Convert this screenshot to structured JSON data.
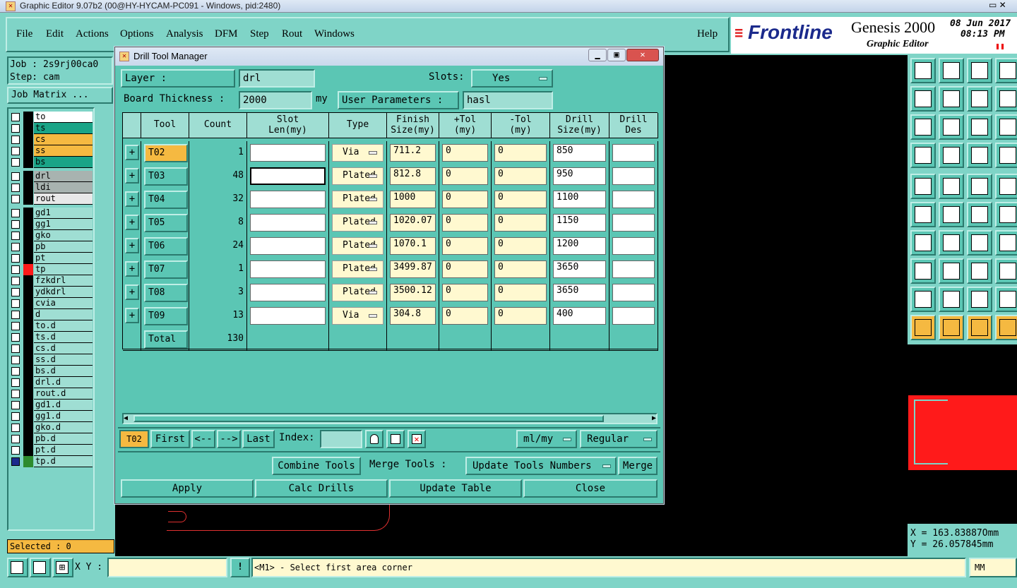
{
  "window": {
    "title": "Graphic Editor 9.07b2 (00@HY-HYCAM-PC091 - Windows, pid:2480)"
  },
  "menu": [
    "File",
    "Edit",
    "Actions",
    "Options",
    "Analysis",
    "DFM",
    "Step",
    "Rout",
    "Windows"
  ],
  "help": "Help",
  "brand": {
    "logo": "Frontline",
    "product": "Genesis 2000",
    "sub": "Graphic Editor",
    "date": "08 Jun 2017",
    "time": "08:13 PM"
  },
  "left": {
    "job": "Job : 2s9rj00ca0",
    "step": "Step: cam",
    "matrix_btn": "Job Matrix ...",
    "selected": "Selected : 0",
    "layers": [
      {
        "name": "to",
        "color": "#ffffff"
      },
      {
        "name": "ts",
        "color": "#1aa487"
      },
      {
        "name": "cs",
        "color": "#f5b941"
      },
      {
        "name": "ss",
        "color": "#f5b941"
      },
      {
        "name": "bs",
        "color": "#1aa487"
      },
      {
        "name": "drl",
        "color": "#a8b3b0"
      },
      {
        "name": "ldi",
        "color": "#a8b3b0"
      },
      {
        "name": "rout",
        "color": "#e8e8e8"
      },
      {
        "name": "gd1",
        "color": "#9fded3"
      },
      {
        "name": "gg1",
        "color": "#9fded3"
      },
      {
        "name": "gko",
        "color": "#9fded3"
      },
      {
        "name": "pb",
        "color": "#9fded3"
      },
      {
        "name": "pt",
        "color": "#9fded3"
      },
      {
        "name": "tp",
        "color": "#9fded3"
      },
      {
        "name": "fzkdrl",
        "color": "#9fded3"
      },
      {
        "name": "ydkdrl",
        "color": "#9fded3"
      },
      {
        "name": "cvia",
        "color": "#9fded3"
      },
      {
        "name": "d",
        "color": "#9fded3"
      },
      {
        "name": "to.d",
        "color": "#9fded3"
      },
      {
        "name": "ts.d",
        "color": "#9fded3"
      },
      {
        "name": "cs.d",
        "color": "#9fded3"
      },
      {
        "name": "ss.d",
        "color": "#9fded3"
      },
      {
        "name": "bs.d",
        "color": "#9fded3"
      },
      {
        "name": "drl.d",
        "color": "#9fded3"
      },
      {
        "name": "rout.d",
        "color": "#9fded3"
      },
      {
        "name": "gd1.d",
        "color": "#9fded3"
      },
      {
        "name": "gg1.d",
        "color": "#9fded3"
      },
      {
        "name": "gko.d",
        "color": "#9fded3"
      },
      {
        "name": "pb.d",
        "color": "#9fded3"
      },
      {
        "name": "pt.d",
        "color": "#9fded3"
      },
      {
        "name": "tp.d",
        "color": "#9fded3"
      }
    ]
  },
  "dialog": {
    "title": "Drill Tool Manager",
    "layer_label": "Layer         :",
    "layer": "drl",
    "slots_label": "Slots:",
    "slots": "Yes",
    "thick_label": "Board Thickness :",
    "thick": "2000",
    "thick_unit": "my",
    "user_params_label": "User Parameters :",
    "user_params": "hasl",
    "headers": [
      [
        "Tool",
        ""
      ],
      [
        "Count",
        ""
      ],
      [
        "Slot",
        "Len(my)"
      ],
      [
        "Type",
        ""
      ],
      [
        "Finish",
        "Size(my)"
      ],
      [
        "+Tol",
        "(my)"
      ],
      [
        "-Tol",
        "(my)"
      ],
      [
        "Drill",
        "Size(my)"
      ],
      [
        "Drill",
        "Des"
      ]
    ],
    "rows": [
      {
        "tool": "T02",
        "count": "1",
        "type": "Via",
        "finish": "711.2",
        "ptol": "0",
        "ntol": "0",
        "drill": "850"
      },
      {
        "tool": "T03",
        "count": "48",
        "type": "Plated",
        "finish": "812.8",
        "ptol": "0",
        "ntol": "0",
        "drill": "950"
      },
      {
        "tool": "T04",
        "count": "32",
        "type": "Plated",
        "finish": "1000",
        "ptol": "0",
        "ntol": "0",
        "drill": "1100"
      },
      {
        "tool": "T05",
        "count": "8",
        "type": "Plated",
        "finish": "1020.07",
        "ptol": "0",
        "ntol": "0",
        "drill": "1150"
      },
      {
        "tool": "T06",
        "count": "24",
        "type": "Plated",
        "finish": "1070.1",
        "ptol": "0",
        "ntol": "0",
        "drill": "1200"
      },
      {
        "tool": "T07",
        "count": "1",
        "type": "Plated",
        "finish": "3499.87",
        "ptol": "0",
        "ntol": "0",
        "drill": "3650"
      },
      {
        "tool": "T08",
        "count": "3",
        "type": "Plated",
        "finish": "3500.12",
        "ptol": "0",
        "ntol": "0",
        "drill": "3650"
      },
      {
        "tool": "T09",
        "count": "13",
        "type": "Via",
        "finish": "304.8",
        "ptol": "0",
        "ntol": "0",
        "drill": "400"
      }
    ],
    "total_label": "Total",
    "total": "130",
    "nav": {
      "current": "T02",
      "first": "First",
      "prev": "<--",
      "next": "-->",
      "last": "Last",
      "index": "Index:",
      "units": "ml/my",
      "mode": "Regular"
    },
    "combine": "Combine Tools",
    "merge_label": "Merge Tools :",
    "update_nums": "Update Tools Numbers",
    "merge": "Merge",
    "apply": "Apply",
    "calc": "Calc Drills",
    "update_table": "Update Table",
    "close": "Close"
  },
  "coords": {
    "x": "X = 163.83887Omm",
    "y": "Y = 26.057845mm"
  },
  "status": {
    "xy_label": "X Y :",
    "msg": "<M1> - Select first area corner",
    "unit": "MM"
  }
}
